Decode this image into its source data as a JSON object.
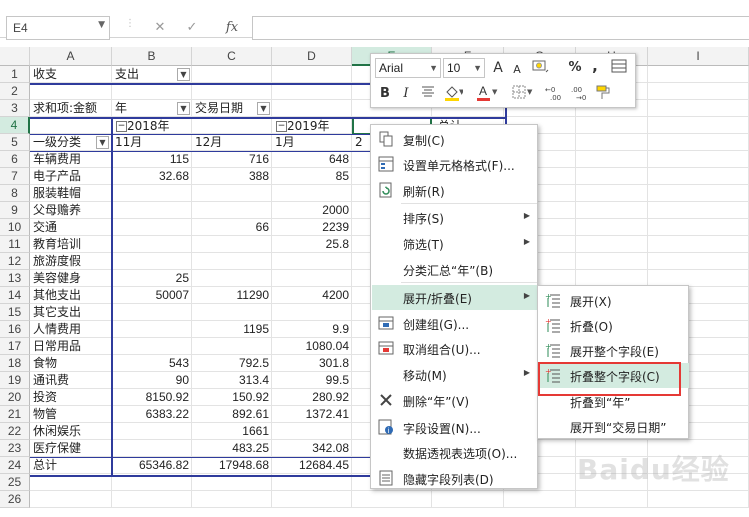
{
  "formula_bar": {
    "name_box": "E4",
    "cancel_icon": "✕",
    "enter_icon": "✓",
    "fx_label": "fx"
  },
  "columns": [
    "A",
    "B",
    "C",
    "D",
    "E",
    "F",
    "G",
    "H",
    "I"
  ],
  "selected_column": "E",
  "rows": [
    "1",
    "2",
    "3",
    "4",
    "5",
    "6",
    "7",
    "8",
    "9",
    "10",
    "11",
    "12",
    "13",
    "14",
    "15",
    "16",
    "17",
    "18",
    "19",
    "20",
    "21",
    "22",
    "23",
    "24",
    "25",
    "26"
  ],
  "selected_row": "4",
  "cells": {
    "a1": "收支",
    "b1": "支出",
    "a3": "求和项:金额",
    "b3": "年",
    "c3": "交易日期",
    "b4": "2018年",
    "d4": "2019年",
    "e4_partial": "总计",
    "a5": "一级分类",
    "b5": "11月",
    "c5": "12月",
    "d5": "1月",
    "e5_partial": "2月"
  },
  "data_rows": [
    {
      "cat": "车辆费用",
      "b": "115",
      "c": "716",
      "d": "648"
    },
    {
      "cat": "电子产品",
      "b": "32.68",
      "c": "388",
      "d": "85"
    },
    {
      "cat": "服装鞋帽",
      "b": "",
      "c": "",
      "d": ""
    },
    {
      "cat": "父母赡养",
      "b": "",
      "c": "",
      "d": "2000"
    },
    {
      "cat": "交通",
      "b": "",
      "c": "66",
      "d": "2239"
    },
    {
      "cat": "教育培训",
      "b": "",
      "c": "",
      "d": "25.8"
    },
    {
      "cat": "旅游度假",
      "b": "",
      "c": "",
      "d": ""
    },
    {
      "cat": "美容健身",
      "b": "25",
      "c": "",
      "d": ""
    },
    {
      "cat": "其他支出",
      "b": "50007",
      "c": "11290",
      "d": "4200"
    },
    {
      "cat": "其它支出",
      "b": "",
      "c": "",
      "d": ""
    },
    {
      "cat": "人情费用",
      "b": "",
      "c": "1195",
      "d": "9.9"
    },
    {
      "cat": "日常用品",
      "b": "",
      "c": "",
      "d": "1080.04"
    },
    {
      "cat": "食物",
      "b": "543",
      "c": "792.5",
      "d": "301.8"
    },
    {
      "cat": "通讯费",
      "b": "90",
      "c": "313.4",
      "d": "99.5"
    },
    {
      "cat": "投资",
      "b": "8150.92",
      "c": "150.92",
      "d": "280.92"
    },
    {
      "cat": "物管",
      "b": "6383.22",
      "c": "892.61",
      "d": "1372.41"
    },
    {
      "cat": "休闲娱乐",
      "b": "",
      "c": "1661",
      "d": ""
    },
    {
      "cat": "医疗保健",
      "b": "",
      "c": "483.25",
      "d": "342.08"
    },
    {
      "cat": "总计",
      "b": "65346.82",
      "c": "17948.68",
      "d": "12684.45"
    }
  ],
  "mini_toolbar": {
    "font_name": "Arial",
    "font_size": "10",
    "grow_font": "A",
    "shrink_font": "A",
    "percent": "%",
    "comma": ",",
    "bold": "B",
    "italic": "I",
    "font_color_letter": "A",
    "inc_decimal": ".0→.00",
    "dec_decimal": ".00→.0",
    "accent_red": "#e53935",
    "accent_yellow": "#ffd600"
  },
  "context_menu": {
    "items": [
      {
        "label": "复制(C)",
        "icon": "copy-icon"
      },
      {
        "label": "设置单元格格式(F)...",
        "icon": "format-cells-icon"
      },
      {
        "label": "刷新(R)",
        "icon": "refresh-icon"
      },
      {
        "label": "排序(S)",
        "icon": "",
        "submenu": true
      },
      {
        "label": "筛选(T)",
        "icon": "",
        "submenu": true
      },
      {
        "label": "分类汇总“年”(B)",
        "icon": ""
      },
      {
        "label": "展开/折叠(E)",
        "icon": "",
        "submenu": true
      },
      {
        "label": "创建组(G)...",
        "icon": "group-icon"
      },
      {
        "label": "取消组合(U)...",
        "icon": "ungroup-icon"
      },
      {
        "label": "移动(M)",
        "icon": "",
        "submenu": true
      },
      {
        "label": "删除“年”(V)",
        "icon": "delete-icon"
      },
      {
        "label": "字段设置(N)...",
        "icon": "field-settings-icon"
      },
      {
        "label": "数据透视表选项(O)...",
        "icon": ""
      },
      {
        "label": "隐藏字段列表(D)",
        "icon": "field-list-icon"
      }
    ],
    "highlight_color": "#d3ebe0"
  },
  "submenu": {
    "items": [
      {
        "label": "展开(X)"
      },
      {
        "label": "折叠(O)"
      },
      {
        "label": "展开整个字段(E)"
      },
      {
        "label": "折叠整个字段(C)"
      },
      {
        "label": "折叠到“年”"
      },
      {
        "label": "展开到“交易日期”"
      }
    ]
  },
  "watermark": "Baidu经验"
}
